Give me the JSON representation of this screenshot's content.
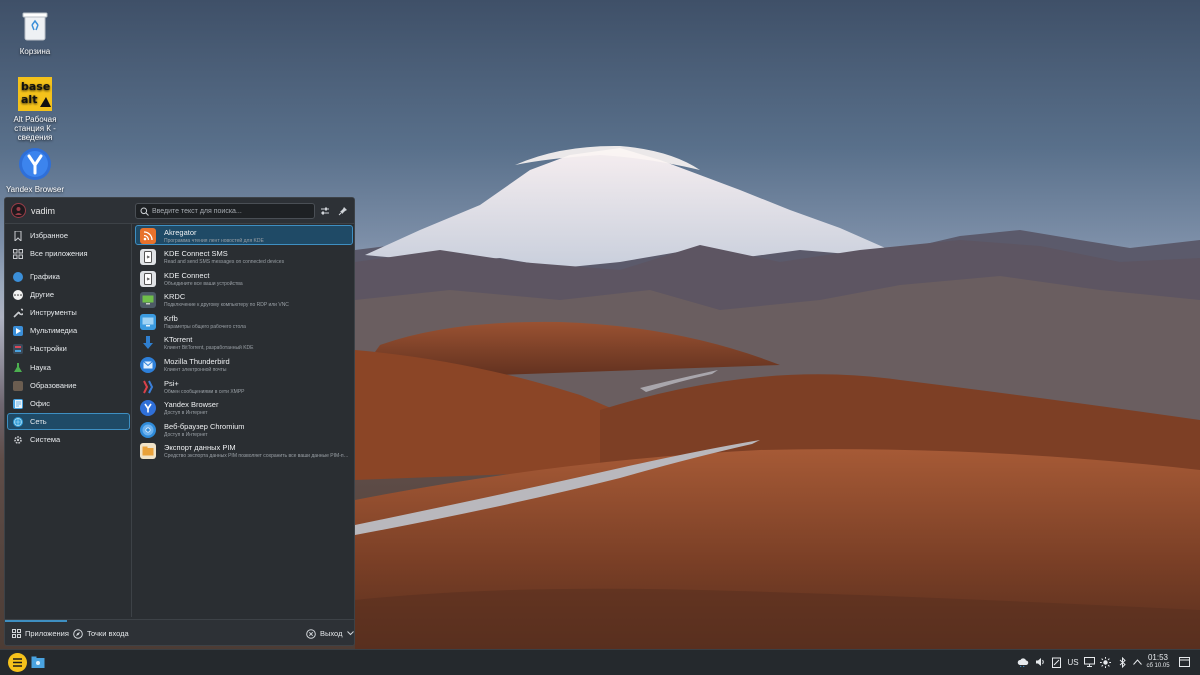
{
  "desktop": {
    "icons": [
      {
        "label": "Корзина",
        "icon": "trash-icon"
      },
      {
        "label": "Alt Рабочая станция К - сведения",
        "icon": "basealt-icon"
      },
      {
        "label": "Yandex Browser",
        "icon": "yandex-browser-icon"
      }
    ],
    "basealt_logo_text": "base alt"
  },
  "launcher": {
    "username": "vadim",
    "search_placeholder": "Введите текст для поиска...",
    "sidebar": [
      {
        "label": "Избранное",
        "icon": "bookmark-icon",
        "color": "#c9ccd0"
      },
      {
        "label": "Все приложения",
        "icon": "grid-icon",
        "color": "#c9ccd0"
      },
      {
        "label": "Графика",
        "icon": "graphics-icon",
        "color": "#3b8fd9"
      },
      {
        "label": "Другие",
        "icon": "other-icon",
        "color": "#ffffff"
      },
      {
        "label": "Инструменты",
        "icon": "wrench-icon",
        "color": "#c9ccd0"
      },
      {
        "label": "Мультимедиа",
        "icon": "multimedia-icon",
        "color": "#3b8fd9"
      },
      {
        "label": "Настройки",
        "icon": "settings-icon",
        "color": "#d94a5a"
      },
      {
        "label": "Наука",
        "icon": "flask-icon",
        "color": "#4caf50"
      },
      {
        "label": "Образование",
        "icon": "education-icon",
        "color": "#8b7b6b"
      },
      {
        "label": "Офис",
        "icon": "office-icon",
        "color": "#4aa3e0"
      },
      {
        "label": "Сеть",
        "icon": "network-icon",
        "color": "#2e9bd6"
      },
      {
        "label": "Система",
        "icon": "system-gear-icon",
        "color": "#c9ccd0"
      }
    ],
    "active_category": "Сеть",
    "apps": [
      {
        "name": "Akregator",
        "desc": "Программа чтения лент новостей для KDE",
        "icon": "akregator-icon",
        "color": "#e8722c"
      },
      {
        "name": "KDE Connect SMS",
        "desc": "Read and send SMS messages on connected devices",
        "icon": "kdeconnect-sms-icon",
        "color": "#dfe2e5"
      },
      {
        "name": "KDE Connect",
        "desc": "Объедините все ваши устройства",
        "icon": "kdeconnect-icon",
        "color": "#dfe2e5"
      },
      {
        "name": "KRDC",
        "desc": "Подключение к другому компьютеру по RDP или VNC",
        "icon": "krdc-icon",
        "color": "#6fbf4a"
      },
      {
        "name": "Krfb",
        "desc": "Параметры общего рабочего стола",
        "icon": "krfb-icon",
        "color": "#3b9be0"
      },
      {
        "name": "KTorrent",
        "desc": "Клиент BitTorrent, разработанный KDE",
        "icon": "ktorrent-icon",
        "color": "#2f7fd0"
      },
      {
        "name": "Mozilla Thunderbird",
        "desc": "Клиент электронной почты",
        "icon": "thunderbird-icon",
        "color": "#2d7fd9"
      },
      {
        "name": "Psi+",
        "desc": "Обмен сообщениями в сети XMPP",
        "icon": "psi-icon",
        "color": "#d9414a"
      },
      {
        "name": "Yandex Browser",
        "desc": "Доступ в Интернет",
        "icon": "yandex-browser-icon",
        "color": "#2f6fd8"
      },
      {
        "name": "Веб-браузер Chromium",
        "desc": "Доступ в Интернет",
        "icon": "chromium-icon",
        "color": "#2f8bd9"
      },
      {
        "name": "Экспорт данных PIM",
        "desc": "Средство экспорта данных PIM позволяет сохранить все ваши данные PIM-прило...",
        "icon": "pim-export-icon",
        "color": "#e9a23b"
      }
    ],
    "footer": {
      "apps_tab": "Приложения",
      "places_tab": "Точки входа",
      "logout": "Выход"
    }
  },
  "taskbar": {
    "keyboard_layout": "US",
    "time": "01:53",
    "date": "сб 10.05"
  }
}
